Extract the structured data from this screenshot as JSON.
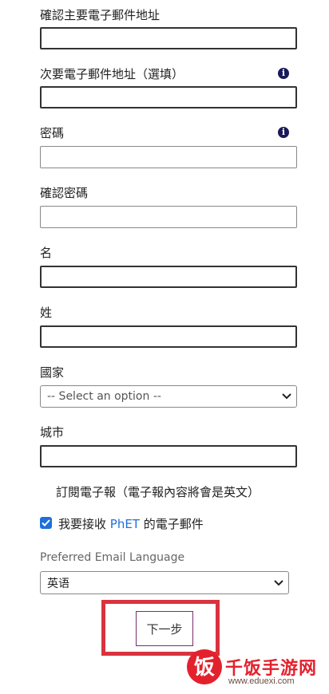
{
  "form": {
    "confirm_email_label": "確認主要電子郵件地址",
    "secondary_email_label": "次要電子郵件地址（選填）",
    "password_label": "密碼",
    "confirm_password_label": "確認密碼",
    "first_name_label": "名",
    "last_name_label": "姓",
    "country_label": "國家",
    "country_value": "-- Select an option --",
    "city_label": "城市",
    "newsletter_heading": "訂閱電子報（電子報內容將會是英文）",
    "receive_email_prefix": "我要接收 ",
    "receive_email_brand": "PhET",
    "receive_email_suffix": " 的電子郵件",
    "receive_email_checked": true,
    "preferred_language_label": "Preferred Email Language",
    "preferred_language_value": "英语",
    "next_button_label": "下一步",
    "info_icon_glyph": "i"
  },
  "watermark": {
    "logo_char": "饭",
    "title": "千饭手游网",
    "url": "www.eduexi.com"
  },
  "colors": {
    "highlight_border": "#d9333f",
    "checkbox_blue": "#1f6fdc",
    "brand_phet": "#1f6fdc",
    "watermark_red": "#e3212d"
  }
}
